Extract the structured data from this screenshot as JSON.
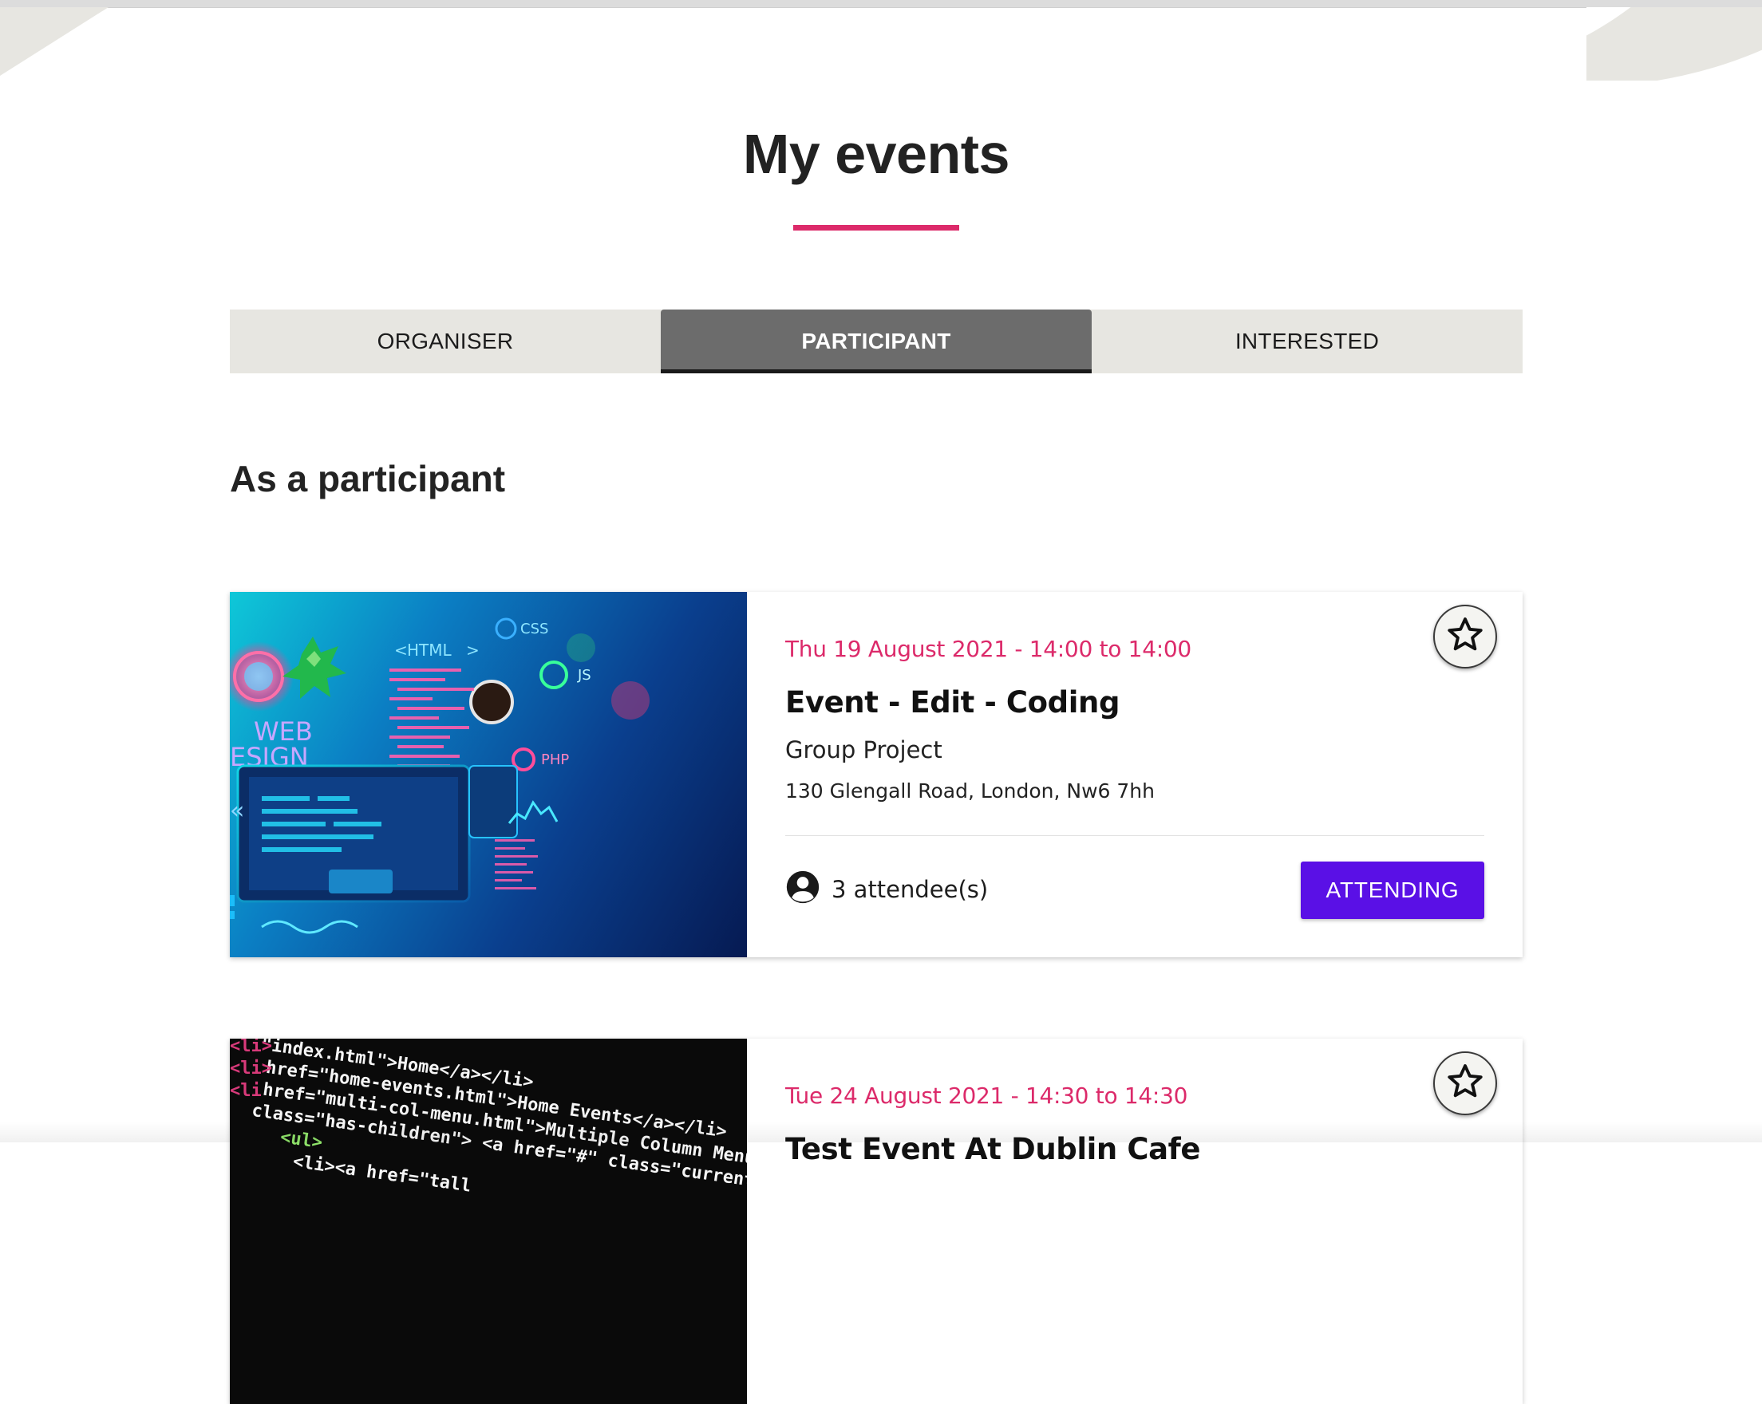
{
  "page": {
    "title": "My events",
    "accent_color": "#dc2a6a"
  },
  "tabs": [
    {
      "label": "ORGANISER",
      "active": false
    },
    {
      "label": "PARTICIPANT",
      "active": true
    },
    {
      "label": "INTERESTED",
      "active": false
    }
  ],
  "section": {
    "title": "As a participant"
  },
  "events": [
    {
      "date": "Thu 19 August 2021 - 14:00 to 14:00",
      "title": "Event - Edit - Coding",
      "group": "Group Project",
      "address": "130 Glengall Road, London, Nw6 7hh",
      "attendees": "3 attendee(s)",
      "button_label": "ATTENDING",
      "image_labels": [
        "HTML",
        "CSS",
        "JS",
        "PHP",
        "WEB",
        "ESIGN"
      ],
      "favorite_icon": "star-outline-icon"
    },
    {
      "date": "Tue 24 August 2021 - 14:30 to 14:30",
      "title": "Test Event At Dublin Cafe",
      "image_code_lines": [
        "\"index.html\">Home</a></li>",
        "href=\"home-events.html\">Home Events</a></li>",
        "href=\"multi-col-menu.html\">Multiple Column Menu on Large",
        "class=\"has-children\"> <a href=\"#\" class=\"current",
        "<ul>",
        "<li><a href=\"tall"
      ],
      "favorite_icon": "star-outline-icon"
    }
  ],
  "colors": {
    "tab_bg": "#e7e6e1",
    "tab_active_bg": "#6c6c6c",
    "button_bg": "#5a10e6"
  }
}
